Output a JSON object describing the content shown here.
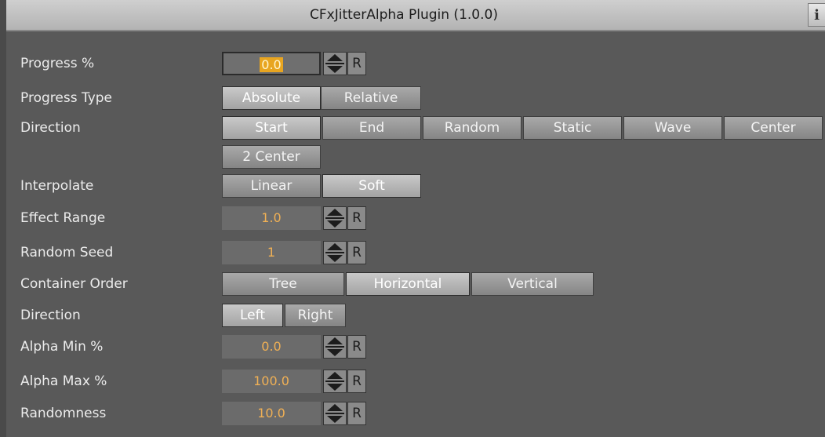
{
  "window": {
    "title": "CFxJitterAlpha Plugin (1.0.0)",
    "info_label": "i"
  },
  "rows": {
    "progress": {
      "label": "Progress %",
      "value": "0.0",
      "reset": "R"
    },
    "progress_type": {
      "label": "Progress Type",
      "options": [
        "Absolute",
        "Relative"
      ],
      "selected": "Absolute"
    },
    "direction": {
      "label": "Direction",
      "options": [
        "Start",
        "End",
        "Random",
        "Static",
        "Wave",
        "Center",
        "2 Center"
      ],
      "selected": "Start"
    },
    "interpolate": {
      "label": "Interpolate",
      "options": [
        "Linear",
        "Soft"
      ],
      "selected": "Soft"
    },
    "effect_range": {
      "label": "Effect Range",
      "value": "1.0",
      "reset": "R"
    },
    "random_seed": {
      "label": "Random Seed",
      "value": "1",
      "reset": "R"
    },
    "container_order": {
      "label": "Container Order",
      "options": [
        "Tree",
        "Horizontal",
        "Vertical"
      ],
      "selected": "Horizontal"
    },
    "direction2": {
      "label": "Direction",
      "options": [
        "Left",
        "Right"
      ],
      "selected": "Left"
    },
    "alpha_min": {
      "label": "Alpha Min %",
      "value": "0.0",
      "reset": "R"
    },
    "alpha_max": {
      "label": "Alpha Max %",
      "value": "100.0",
      "reset": "R"
    },
    "randomness": {
      "label": "Randomness",
      "value": "10.0",
      "reset": "R"
    }
  },
  "colors": {
    "background": "#595959",
    "value_text": "#f0b055",
    "active_value": "#e8a520"
  }
}
